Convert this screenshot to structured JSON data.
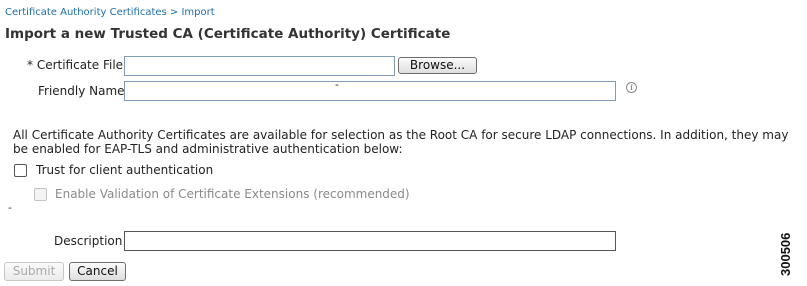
{
  "breadcrumb": "Certificate Authority Certificates > Import",
  "page_title": "Import a new Trusted CA (Certificate Authority) Certificate",
  "certificate_file": {
    "label": "* Certificate File",
    "value": "",
    "browse_label": "Browse..."
  },
  "friendly_name": {
    "label": "Friendly Name",
    "value": "",
    "cursor_mark": "-",
    "info_icon": "info-icon",
    "info_glyph": "i"
  },
  "info_text": "All Certificate Authority Certificates are available for selection as the Root CA for secure LDAP connections. In addition, they may be enabled for EAP-TLS and administrative authentication below:",
  "trust_client_auth": {
    "label": "Trust for client authentication",
    "checked": false
  },
  "enable_validation": {
    "label": "Enable Validation of Certificate Extensions (recommended)",
    "checked": false,
    "disabled": true
  },
  "stray_mark": "-",
  "description": {
    "label": "Description",
    "value": ""
  },
  "buttons": {
    "submit": "Submit",
    "cancel": "Cancel"
  },
  "figure_number": "300506",
  "colors": {
    "breadcrumb_link": "#1f6fa8",
    "input_border": "#7f9db9",
    "disabled_text": "#8a8a8a"
  }
}
